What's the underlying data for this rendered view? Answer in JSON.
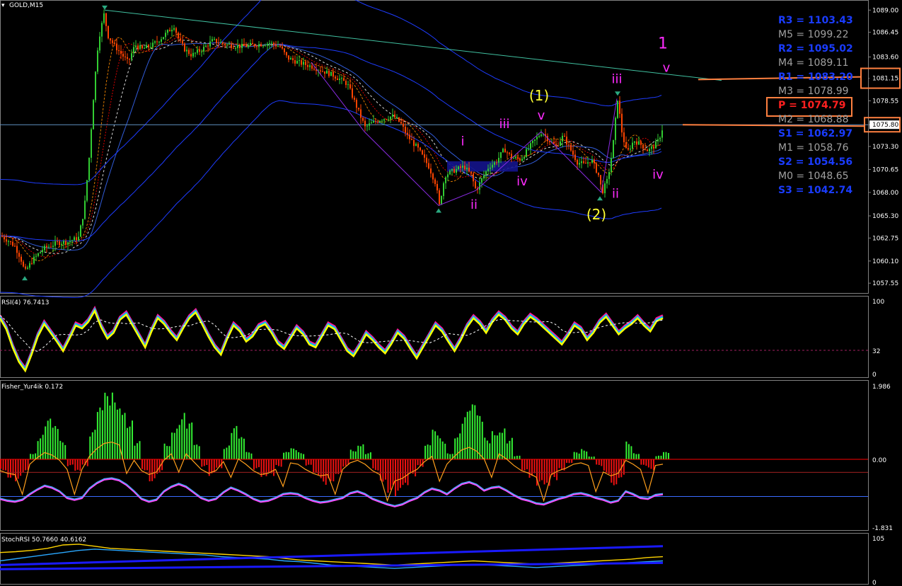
{
  "window": {
    "symbol_label": "GOLD,M15"
  },
  "colors": {
    "background": "#000000",
    "frame": "#808080",
    "bull": "#32cd32",
    "bear": "#ff4500",
    "trendline": "#40c0a0",
    "envelope": "#1e3cff",
    "wave_label": "#ff2bff",
    "degree_label": "#ffff33",
    "pivot_box": "#ff8040",
    "pivot_text": "#ff2020",
    "resist_text": "#1a3cff",
    "mid_text": "#a0a0a0"
  },
  "chart_data": [
    {
      "type": "candlestick",
      "title": "GOLD,M15",
      "ylim": [
        1056.5,
        1090.0
      ],
      "y_ticks": [
        "1089.00",
        "1086.45",
        "1083.60",
        "1081.15",
        "1078.55",
        "1075.80",
        "1073.30",
        "1070.65",
        "1068.00",
        "1065.30",
        "1062.75",
        "1060.10",
        "1057.55"
      ],
      "y_tick_values": [
        1089.0,
        1086.45,
        1083.6,
        1081.15,
        1078.55,
        1075.8,
        1073.3,
        1070.65,
        1068.0,
        1065.3,
        1062.75,
        1060.1,
        1057.55
      ],
      "highlighted_prices": [
        "1081.15",
        "1075.80"
      ],
      "current_price": 1075.8,
      "price_path": [
        [
          0,
          1063.0
        ],
        [
          10,
          1062.5
        ],
        [
          20,
          1061.8
        ],
        [
          28,
          1060.5
        ],
        [
          34,
          1058.8
        ],
        [
          45,
          1060.2
        ],
        [
          60,
          1061.5
        ],
        [
          80,
          1062.2
        ],
        [
          95,
          1062.3
        ],
        [
          110,
          1062.8
        ],
        [
          118,
          1066.0
        ],
        [
          125,
          1072.0
        ],
        [
          132,
          1080.0
        ],
        [
          138,
          1085.5
        ],
        [
          146,
          1088.5
        ],
        [
          152,
          1086.0
        ],
        [
          160,
          1085.0
        ],
        [
          170,
          1084.0
        ],
        [
          180,
          1083.0
        ],
        [
          190,
          1085.0
        ],
        [
          200,
          1084.5
        ],
        [
          215,
          1085.0
        ],
        [
          230,
          1086.0
        ],
        [
          245,
          1087.2
        ],
        [
          252,
          1085.5
        ],
        [
          260,
          1084.5
        ],
        [
          270,
          1083.8
        ],
        [
          285,
          1084.5
        ],
        [
          300,
          1085.5
        ],
        [
          320,
          1085.0
        ],
        [
          340,
          1084.8
        ],
        [
          360,
          1085.0
        ],
        [
          380,
          1085.2
        ],
        [
          395,
          1084.8
        ],
        [
          405,
          1083.5
        ],
        [
          420,
          1083.0
        ],
        [
          440,
          1082.5
        ],
        [
          455,
          1082.0
        ],
        [
          470,
          1081.5
        ],
        [
          490,
          1080.5
        ],
        [
          505,
          1077.5
        ],
        [
          515,
          1075.5
        ],
        [
          525,
          1076.0
        ],
        [
          540,
          1076.5
        ],
        [
          555,
          1076.8
        ],
        [
          565,
          1076.0
        ],
        [
          575,
          1074.5
        ],
        [
          590,
          1073.0
        ],
        [
          605,
          1071.0
        ],
        [
          615,
          1069.0
        ],
        [
          620,
          1066.5
        ],
        [
          628,
          1070.0
        ],
        [
          640,
          1070.5
        ],
        [
          655,
          1071.0
        ],
        [
          665,
          1070.0
        ],
        [
          672,
          1068.2
        ],
        [
          680,
          1069.5
        ],
        [
          690,
          1071.0
        ],
        [
          700,
          1071.5
        ],
        [
          712,
          1073.0
        ],
        [
          722,
          1072.0
        ],
        [
          735,
          1071.8
        ],
        [
          750,
          1073.5
        ],
        [
          765,
          1075.0
        ],
        [
          775,
          1074.0
        ],
        [
          785,
          1073.3
        ],
        [
          795,
          1074.5
        ],
        [
          805,
          1073.0
        ],
        [
          815,
          1071.5
        ],
        [
          825,
          1071.2
        ],
        [
          835,
          1071.8
        ],
        [
          845,
          1070.0
        ],
        [
          850,
          1068.0
        ],
        [
          858,
          1069.5
        ],
        [
          865,
          1073.0
        ],
        [
          872,
          1078.8
        ],
        [
          878,
          1075.0
        ],
        [
          885,
          1072.5
        ],
        [
          895,
          1074.0
        ],
        [
          905,
          1073.5
        ],
        [
          915,
          1072.8
        ],
        [
          922,
          1073.2
        ],
        [
          930,
          1074.0
        ],
        [
          937,
          1075.8
        ]
      ],
      "trendline": {
        "from": [
          148,
          1089.0
        ],
        "to": [
          1020,
          1080.9
        ]
      },
      "wave_labels": [
        {
          "text": "1",
          "x": 937,
          "y": 1084.6,
          "role": "degree-top"
        },
        {
          "text": "v",
          "x": 942,
          "y": 1081.9,
          "role": "minor"
        },
        {
          "text": "(1)",
          "x": 762,
          "y": 1078.6,
          "role": "intermediate"
        },
        {
          "text": "v",
          "x": 765,
          "y": 1076.4,
          "role": "minor"
        },
        {
          "text": "iii",
          "x": 872,
          "y": 1080.6,
          "role": "minor"
        },
        {
          "text": "iii",
          "x": 713,
          "y": 1075.4,
          "role": "minor"
        },
        {
          "text": "i",
          "x": 654,
          "y": 1073.4,
          "role": "minor"
        },
        {
          "text": "iv",
          "x": 738,
          "y": 1068.8,
          "role": "minor"
        },
        {
          "text": "ii",
          "x": 670,
          "y": 1066.1,
          "role": "minor"
        },
        {
          "text": "ii",
          "x": 870,
          "y": 1067.4,
          "role": "minor"
        },
        {
          "text": "(2)",
          "x": 843,
          "y": 1064.9,
          "role": "intermediate"
        },
        {
          "text": "iv",
          "x": 930,
          "y": 1069.6,
          "role": "minor"
        }
      ],
      "pivot_levels": [
        {
          "label": "R3",
          "value": "1103.43",
          "kind": "resistance"
        },
        {
          "label": "M5",
          "value": "1099.22",
          "kind": "mid"
        },
        {
          "label": "R2",
          "value": "1095.02",
          "kind": "resistance"
        },
        {
          "label": "M4",
          "value": "1089.11",
          "kind": "mid"
        },
        {
          "label": "R1",
          "value": "1083.20",
          "kind": "resistance"
        },
        {
          "label": "M3",
          "value": "1078.99",
          "kind": "mid"
        },
        {
          "label": "P",
          "value": "1074.79",
          "kind": "pivot"
        },
        {
          "label": "M2",
          "value": "1068.88",
          "kind": "mid"
        },
        {
          "label": "S1",
          "value": "1062.97",
          "kind": "support"
        },
        {
          "label": "M1",
          "value": "1058.76",
          "kind": "mid"
        },
        {
          "label": "S2",
          "value": "1054.56",
          "kind": "support"
        },
        {
          "label": "M0",
          "value": "1048.65",
          "kind": "mid"
        },
        {
          "label": "S3",
          "value": "1042.74",
          "kind": "support"
        }
      ]
    },
    {
      "type": "line",
      "title": "RSI(4) 76.7413",
      "ylim": [
        0,
        100
      ],
      "y_ticks": [
        "100",
        "32",
        "0"
      ],
      "y_tick_values": [
        100,
        32,
        0
      ],
      "level": 32,
      "series": [
        {
          "values": [
            80,
            65,
            40,
            20,
            8,
            30,
            55,
            72,
            60,
            48,
            35,
            52,
            70,
            66,
            75,
            90,
            68,
            52,
            60,
            78,
            85,
            70,
            55,
            40,
            62,
            80,
            72,
            60,
            50,
            66,
            80,
            88,
            72,
            55,
            40,
            30,
            52,
            70,
            62,
            48,
            55,
            68,
            72,
            60,
            45,
            38,
            52,
            66,
            58,
            44,
            40,
            55,
            70,
            65,
            50,
            35,
            28,
            42,
            58,
            50,
            40,
            32,
            45,
            60,
            52,
            38,
            25,
            40,
            55,
            70,
            62,
            48,
            35,
            50,
            68,
            80,
            72,
            60,
            75,
            85,
            78,
            66,
            58,
            72,
            82,
            76,
            68,
            60,
            52,
            44,
            56,
            70,
            64,
            50,
            60,
            74,
            82,
            70,
            58,
            66,
            72,
            80,
            70,
            62,
            76,
            80
          ]
        }
      ]
    },
    {
      "type": "bar",
      "title": "Fisher_Yur4ik 0.172",
      "ylim": [
        -1.831,
        1.986
      ],
      "y_ticks": [
        "1.986",
        "0.00",
        "-1.831"
      ],
      "y_tick_values": [
        1.986,
        0,
        -1.831
      ],
      "current_value": 0.172,
      "histogram": [
        -0.3,
        -0.5,
        -0.6,
        -0.4,
        0.2,
        0.7,
        1.1,
        0.9,
        0.5,
        -0.2,
        -0.4,
        -0.2,
        0.8,
        1.4,
        1.8,
        1.9,
        1.7,
        1.2,
        0.5,
        -0.3,
        -0.6,
        -0.4,
        0.5,
        1.0,
        1.3,
        1.0,
        0.4,
        -0.2,
        -0.5,
        -0.3,
        0.4,
        0.9,
        0.6,
        0.2,
        -0.3,
        -0.6,
        -0.5,
        -0.2,
        0.2,
        0.3,
        0.2,
        -0.2,
        -0.5,
        -0.7,
        -0.6,
        -0.4,
        -0.2,
        0.3,
        0.5,
        0.2,
        -0.3,
        -0.6,
        -0.9,
        -1.1,
        -0.9,
        -0.5,
        -0.2,
        0.4,
        0.8,
        0.6,
        0.2,
        0.8,
        1.3,
        1.5,
        1.2,
        0.6,
        0.9,
        1.0,
        0.6,
        0.1,
        -0.3,
        -0.5,
        -0.8,
        -0.9,
        -0.6,
        -0.3,
        -0.1,
        0.2,
        0.3,
        0.1,
        -0.2,
        -0.4,
        -0.7,
        -0.5,
        0.5,
        0.2,
        -0.2,
        -0.3,
        0.1,
        0.2
      ]
    },
    {
      "type": "line",
      "title": "StochRSI 50.7660 40.6162",
      "ylim": [
        0,
        105
      ],
      "y_ticks": [
        "105",
        "0"
      ],
      "y_tick_values": [
        105,
        0
      ],
      "series": [
        {
          "values": [
            70,
            72,
            75,
            80,
            88,
            90,
            85,
            80,
            78,
            76,
            74,
            72,
            70,
            68,
            66,
            64,
            62,
            60,
            56,
            52,
            50,
            48,
            46,
            44,
            42,
            40,
            42,
            44,
            46,
            48,
            50,
            48,
            46,
            44,
            42,
            44,
            46,
            48,
            50,
            52,
            54,
            58,
            60
          ]
        },
        {
          "values": [
            50,
            55,
            60,
            65,
            70,
            75,
            78,
            76,
            74,
            72,
            70,
            68,
            66,
            64,
            60,
            58,
            56,
            54,
            50,
            48,
            44,
            40,
            38,
            36,
            34,
            32,
            34,
            36,
            38,
            40,
            42,
            40,
            38,
            36,
            34,
            36,
            38,
            40,
            42,
            44,
            46,
            48,
            50
          ]
        }
      ]
    }
  ]
}
